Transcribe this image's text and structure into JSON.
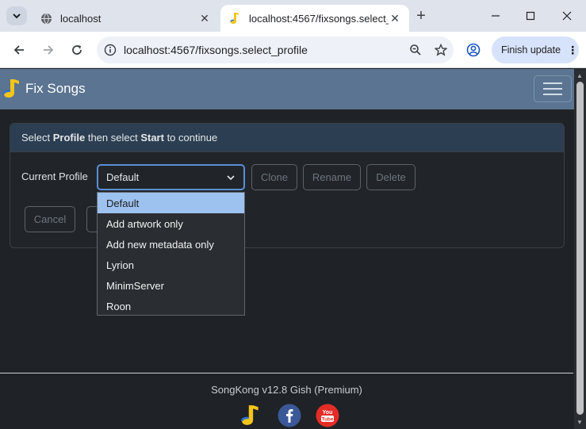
{
  "browser": {
    "tabs": [
      {
        "title": "localhost"
      },
      {
        "title": "localhost:4567/fixsongs.select_p"
      }
    ],
    "url": "localhost:4567/fixsongs.select_profile",
    "update_label": "Finish update"
  },
  "app": {
    "brand": "Fix Songs",
    "card_header": {
      "part1": "Select ",
      "bold1": "Profile",
      "part2": " then select ",
      "bold2": "Start",
      "part3": " to continue"
    },
    "profile_label": "Current Profile",
    "select_value": "Default",
    "buttons": {
      "clone": "Clone",
      "rename": "Rename",
      "delete": "Delete",
      "cancel": "Cancel"
    },
    "options": [
      "Default",
      "Add artwork only",
      "Add new metadata only",
      "Lyrion",
      "MinimServer",
      "Roon"
    ],
    "footer": "SongKong v12.8 Gish (Premium)"
  },
  "colors": {
    "nav": "#5b7491",
    "selected_option": "#9ec2ef",
    "background": "#1f2226"
  }
}
